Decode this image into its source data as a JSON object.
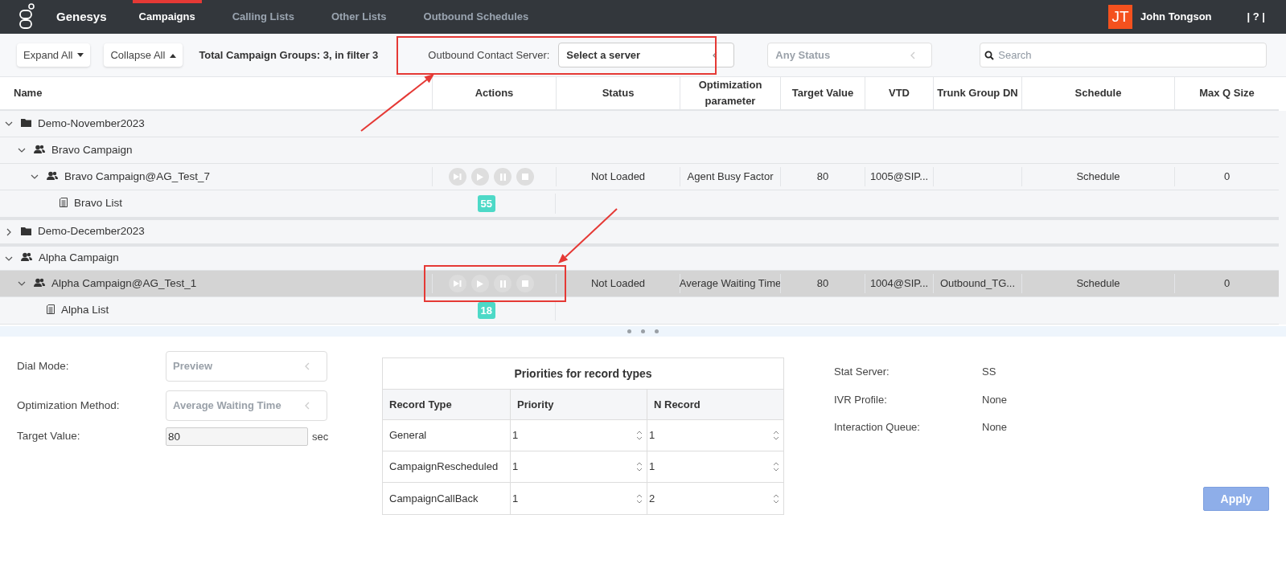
{
  "nav": {
    "brand": "Genesys",
    "tabs": [
      {
        "label": "Campaigns",
        "selected": true
      },
      {
        "label": "Calling Lists",
        "selected": false
      },
      {
        "label": "Other Lists",
        "selected": false
      },
      {
        "label": "Outbound Schedules",
        "selected": false
      }
    ],
    "user": {
      "initials": "JT",
      "name": "John Tongson"
    },
    "help": "| ? |"
  },
  "toolbar": {
    "expand_button": "Expand All",
    "collapse_button": "Collapse All",
    "total": "Total Campaign Groups: 3, in filter 3",
    "server_label": "Outbound Contact Server:",
    "server_select": "Select a server",
    "status_select": {
      "value": "Any Status",
      "disabled": true
    },
    "search": {
      "placeholder": "Search"
    }
  },
  "table": {
    "columns": [
      "Name",
      "Actions",
      "Status",
      "Optimization parameter",
      "Target Value",
      "VTD",
      "Trunk Group DN",
      "Schedule",
      "Max Q Size"
    ],
    "rows": [
      {
        "kind": "group",
        "name": "Demo-November2023",
        "expanded": true,
        "selected": false,
        "children": [
          {
            "kind": "campaign",
            "name": "Bravo Campaign",
            "expanded": true,
            "selected": false,
            "children": [
              {
                "kind": "campaign_group",
                "name": "Bravo Campaign@AG_Test_7",
                "expanded": true,
                "selected": false,
                "actions_disabled": true,
                "status": "Not Loaded",
                "optimization": "Agent Busy Factor",
                "target_value": "80",
                "vtd": "1005@SIP...",
                "schedule": "Schedule",
                "max_q_size": "0",
                "children": [
                  {
                    "kind": "list",
                    "name": "Bravo List",
                    "count": "55",
                    "selected": false
                  }
                ]
              }
            ]
          }
        ]
      },
      {
        "kind": "group",
        "name": "Demo-December2023",
        "expanded": false,
        "selected": false
      },
      {
        "kind": "campaign",
        "name": "Alpha Campaign",
        "expanded": true,
        "selected": false,
        "children": [
          {
            "kind": "campaign_group",
            "name": "Alpha Campaign@AG_Test_1",
            "expanded": true,
            "selected": true,
            "actions_disabled": true,
            "status": "Not Loaded",
            "optimization": "Average Waiting Time",
            "target_value": "80",
            "vtd": "1004@SIP...",
            "trunk_group_dn": "Outbound_TG...",
            "schedule": "Schedule",
            "max_q_size": "0",
            "children": [
              {
                "kind": "list",
                "name": "Alpha List",
                "count": "18",
                "selected": false
              }
            ]
          }
        ]
      }
    ]
  },
  "details": {
    "fields": [
      {
        "kind": "select",
        "label": "Dial Mode:",
        "value": "Preview",
        "disabled": true
      },
      {
        "kind": "select",
        "label": "Optimization Method:",
        "value": "Average Waiting Time",
        "disabled": true
      },
      {
        "kind": "input",
        "label": "Target Value:",
        "value": "80",
        "unit": "sec"
      }
    ],
    "priorities": {
      "title": "Priorities for record types",
      "columns": [
        "Record Type",
        "Priority",
        "N Record"
      ],
      "rows": [
        {
          "record_type": "General",
          "priority": "1",
          "n_record": "1"
        },
        {
          "record_type": "CampaignRescheduled",
          "priority": "1",
          "n_record": "1"
        },
        {
          "record_type": "CampaignCallBack",
          "priority": "1",
          "n_record": "2"
        }
      ]
    },
    "info": [
      {
        "label": "Stat Server:",
        "value": "SS"
      },
      {
        "label": "IVR Profile:",
        "value": "None"
      },
      {
        "label": "Interaction Queue:",
        "value": "None"
      }
    ],
    "apply_button": {
      "label": "Apply",
      "disabled": true
    }
  }
}
